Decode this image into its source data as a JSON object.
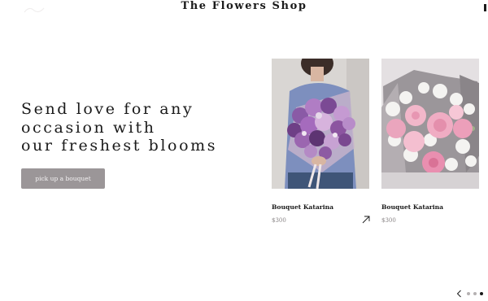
{
  "header": {
    "title": "The Flowers Shop",
    "logo_icon": "logo-mark-icon",
    "menu_icon": "menu-icon"
  },
  "hero": {
    "lines": [
      "Send love for any",
      "occasion with",
      "our freshest blooms"
    ],
    "cta_label": "pick up a bouquet"
  },
  "products": [
    {
      "name": "Bouquet Katarina",
      "price": "$300",
      "image_icon": "purple-bouquet-photo",
      "show_arrow": true
    },
    {
      "name": "Bouquet Katarina",
      "price": "$300",
      "image_icon": "pink-peony-bouquet-photo",
      "show_arrow": false
    }
  ],
  "slider": {
    "prev_icon": "chevron-left-icon",
    "dots": 3,
    "active_dot": 3
  },
  "colors": {
    "cta_bg": "#9b9698",
    "text": "#1a1a1a",
    "price": "#8a8587"
  }
}
